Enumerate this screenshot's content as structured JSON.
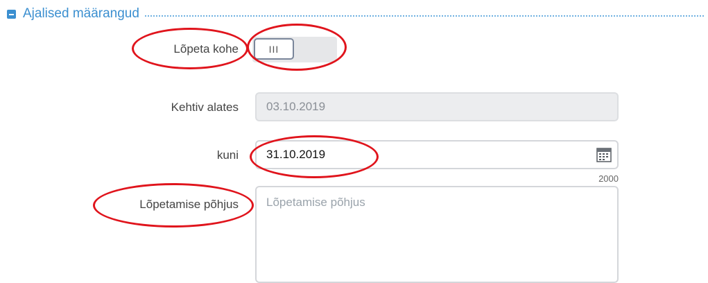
{
  "section": {
    "title": "Ajalised määrangud"
  },
  "fields": {
    "lopeta_kohe": {
      "label": "Lõpeta kohe",
      "toggle_text": "III"
    },
    "kehtiv_alates": {
      "label": "Kehtiv alates",
      "value": "03.10.2019"
    },
    "kuni": {
      "label": "kuni",
      "value": "31.10.2019",
      "counter": "2000"
    },
    "lopetamise_pohjus": {
      "label": "Lõpetamise põhjus",
      "placeholder": "Lõpetamise põhjus"
    }
  },
  "colors": {
    "accent": "#3b8fd0",
    "annotation": "#e0141c",
    "disabled_bg": "#ecedef"
  },
  "icons": [
    "collapse-icon",
    "calendar-icon"
  ]
}
